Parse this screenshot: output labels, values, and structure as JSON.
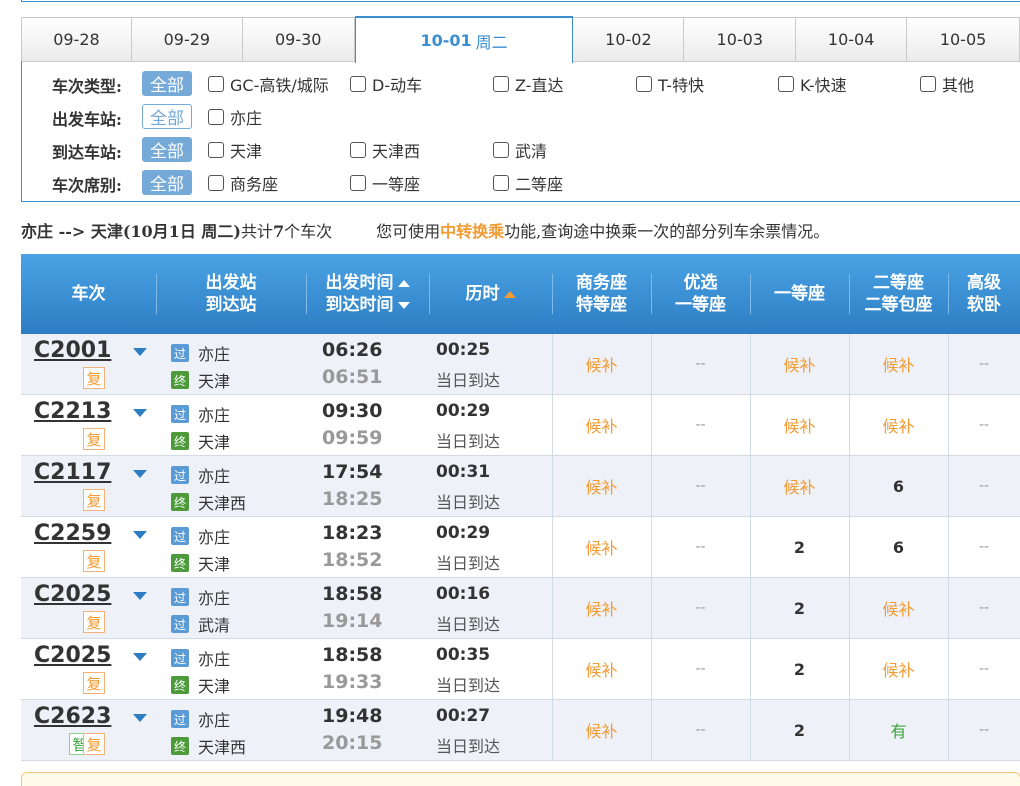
{
  "date_tabs": [
    {
      "date": "09-28",
      "weekday": ""
    },
    {
      "date": "09-29",
      "weekday": ""
    },
    {
      "date": "09-30",
      "weekday": ""
    },
    {
      "date": "10-01",
      "weekday": "周二",
      "active": true
    },
    {
      "date": "10-02",
      "weekday": ""
    },
    {
      "date": "10-03",
      "weekday": ""
    },
    {
      "date": "10-04",
      "weekday": ""
    },
    {
      "date": "10-05",
      "weekday": ""
    }
  ],
  "filters": {
    "train_type": {
      "label": "车次类型:",
      "all": "全部",
      "options": [
        "GC-高铁/城际",
        "D-动车",
        "Z-直达",
        "T-特快",
        "K-快速",
        "其他"
      ]
    },
    "departure": {
      "label": "出发车站:",
      "all": "全部",
      "options": [
        "亦庄"
      ]
    },
    "arrival": {
      "label": "到达车站:",
      "all": "全部",
      "options": [
        "天津",
        "天津西",
        "武清"
      ]
    },
    "seat_class": {
      "label": "车次席别:",
      "all": "全部",
      "options": [
        "商务座",
        "一等座",
        "二等座"
      ]
    }
  },
  "summary": {
    "route": "亦庄 --> 天津",
    "date_text": "(10月1日  周二)",
    "count_prefix": "共计",
    "count": "7",
    "count_suffix": "个车次",
    "hint_prefix": "您可使用",
    "hint_link": "中转换乘",
    "hint_suffix": "功能,查询途中换乘一次的部分列车余票情况。"
  },
  "table_headers": {
    "train": "车次",
    "station_1": "出发站",
    "station_2": "到达站",
    "time_1": "出发时间",
    "time_2": "到达时间",
    "duration": "历时",
    "business_1": "商务座",
    "business_2": "特等座",
    "premium_1": "优选",
    "premium_2": "一等座",
    "first": "一等座",
    "second_1": "二等座",
    "second_2": "二等包座",
    "soft_1": "高级",
    "soft_2": "软卧"
  },
  "trains": [
    {
      "no": "C2001",
      "tags": [
        "复"
      ],
      "from_icon": "过",
      "from": "亦庄",
      "to_icon": "终",
      "to": "天津",
      "dep": "06:26",
      "arr": "06:51",
      "dur": "00:25",
      "dur_note": "当日到达",
      "business": "候补",
      "premium": "--",
      "first": "候补",
      "second": "候补",
      "soft": "--"
    },
    {
      "no": "C2213",
      "tags": [
        "复"
      ],
      "from_icon": "过",
      "from": "亦庄",
      "to_icon": "终",
      "to": "天津",
      "dep": "09:30",
      "arr": "09:59",
      "dur": "00:29",
      "dur_note": "当日到达",
      "business": "候补",
      "premium": "--",
      "first": "候补",
      "second": "候补",
      "soft": "--"
    },
    {
      "no": "C2117",
      "tags": [
        "复"
      ],
      "from_icon": "过",
      "from": "亦庄",
      "to_icon": "终",
      "to": "天津西",
      "dep": "17:54",
      "arr": "18:25",
      "dur": "00:31",
      "dur_note": "当日到达",
      "business": "候补",
      "premium": "--",
      "first": "候补",
      "second": "6",
      "soft": "--"
    },
    {
      "no": "C2259",
      "tags": [
        "复"
      ],
      "from_icon": "过",
      "from": "亦庄",
      "to_icon": "终",
      "to": "天津",
      "dep": "18:23",
      "arr": "18:52",
      "dur": "00:29",
      "dur_note": "当日到达",
      "business": "候补",
      "premium": "--",
      "first": "2",
      "second": "6",
      "soft": "--"
    },
    {
      "no": "C2025",
      "tags": [
        "复"
      ],
      "from_icon": "过",
      "from": "亦庄",
      "to_icon": "过",
      "to": "武清",
      "dep": "18:58",
      "arr": "19:14",
      "dur": "00:16",
      "dur_note": "当日到达",
      "business": "候补",
      "premium": "--",
      "first": "2",
      "second": "候补",
      "soft": "--"
    },
    {
      "no": "C2025",
      "tags": [
        "复"
      ],
      "from_icon": "过",
      "from": "亦庄",
      "to_icon": "终",
      "to": "天津",
      "dep": "18:58",
      "arr": "19:33",
      "dur": "00:35",
      "dur_note": "当日到达",
      "business": "候补",
      "premium": "--",
      "first": "2",
      "second": "候补",
      "soft": "--"
    },
    {
      "no": "C2623",
      "tags": [
        "智",
        "复"
      ],
      "from_icon": "过",
      "from": "亦庄",
      "to_icon": "终",
      "to": "天津西",
      "dep": "19:48",
      "arr": "20:15",
      "dur": "00:27",
      "dur_note": "当日到达",
      "business": "候补",
      "premium": "--",
      "first": "2",
      "second": "有",
      "soft": "--"
    }
  ],
  "colors": {
    "accent": "#3b8fd0",
    "header_bg": "#2d7dc3",
    "orange": "#f39b33",
    "green": "#3aa23a"
  }
}
